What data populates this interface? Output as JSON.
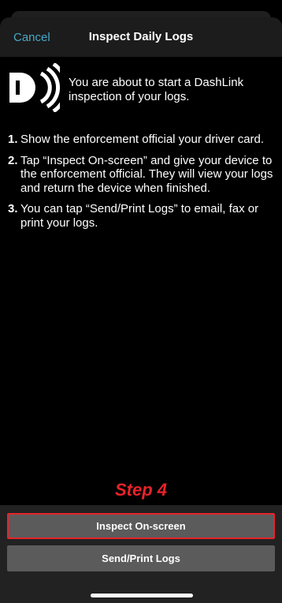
{
  "header": {
    "cancel_label": "Cancel",
    "title": "Inspect Daily Logs"
  },
  "logo": {
    "icon": "dashlink-logo-icon"
  },
  "intro_text": "You are about to start a DashLink inspection of your logs.",
  "steps": [
    {
      "number": "1.",
      "text": "Show the enforcement official your driver card."
    },
    {
      "number": "2.",
      "text": "Tap “Inspect On-screen” and give your device to the enforcement official. They will view your logs and return the device when finished."
    },
    {
      "number": "3.",
      "text": "You can tap “Send/Print Logs” to email, fax or print your logs."
    }
  ],
  "annotation": {
    "label": "Step 4",
    "color": "#e8222a"
  },
  "buttons": {
    "inspect_label": "Inspect On-screen",
    "send_label": "Send/Print Logs"
  },
  "colors": {
    "accent": "#4aa8c8",
    "background": "#000000",
    "button": "#5b5b5b",
    "highlight": "#e8222a"
  }
}
